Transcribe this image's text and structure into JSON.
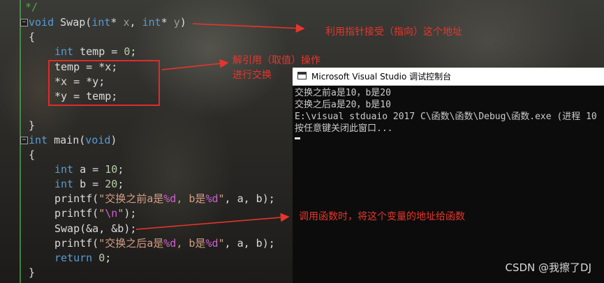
{
  "code": {
    "comment_end": "*/",
    "swap_sig": {
      "kw_void": "void",
      "name": " Swap(",
      "type1": "int",
      "star1": "* ",
      "p1": "x",
      "comma": ", ",
      "type2": "int",
      "star2": "* ",
      "p2": "y",
      "close": ")"
    },
    "open_brace": "{",
    "close_brace": "}",
    "line_temp_decl": {
      "kw": "int",
      "rest": " temp = ",
      "num": "0",
      "end": ";"
    },
    "line_temp_assign": "temp = *x;",
    "line_x_assign": "*x = *y;",
    "line_y_assign": "*y = temp;",
    "main_sig": {
      "kw_int": "int",
      "name": " main(",
      "kw_void": "void",
      "close": ")"
    },
    "line_a": {
      "kw": "int",
      "rest": " a = ",
      "num": "10",
      "end": ";"
    },
    "line_b": {
      "kw": "int",
      "rest": " b = ",
      "num": "20",
      "end": ";"
    },
    "printf1": {
      "call": "printf(",
      "s1": "\"交换之前a是",
      "f1": "%d",
      "s2": ", b是",
      "f2": "%d",
      "s3": "\"",
      "rest": ", a, b);"
    },
    "printf2": {
      "call": "printf(",
      "s1": "\"",
      "esc": "\\n",
      "s2": "\"",
      "rest": ");"
    },
    "swap_call": "Swap(&a, &b);",
    "printf3": {
      "call": "printf(",
      "s1": "\"交换之后a是",
      "f1": "%d",
      "s2": ", b是",
      "f2": "%d",
      "s3": "\"",
      "rest": ", a, b);"
    },
    "return_line": {
      "kw": "return",
      "rest": " ",
      "num": "0",
      "end": ";"
    }
  },
  "annotations": {
    "pointer_receive": "利用指针接受（指向）这个地址",
    "dereference_line1": "解引用（取值）操作",
    "dereference_line2": "进行交换",
    "call_note": "调用函数时，将这个变量的地址给函数"
  },
  "console": {
    "title": "Microsoft Visual Studio 调试控制台",
    "lines": [
      "交换之前a是10，b是20",
      "交换之后a是20，b是10",
      "E:\\visual stduaio 2017 C\\函数\\函数\\Debug\\函数.exe (进程 10",
      "按任意键关闭此窗口..."
    ]
  },
  "watermark": "CSDN @我擦了DJ",
  "colors": {
    "annotation": "#e8352b",
    "keyword": "#569cd6",
    "string": "#d69d85",
    "format": "#d060d0"
  }
}
